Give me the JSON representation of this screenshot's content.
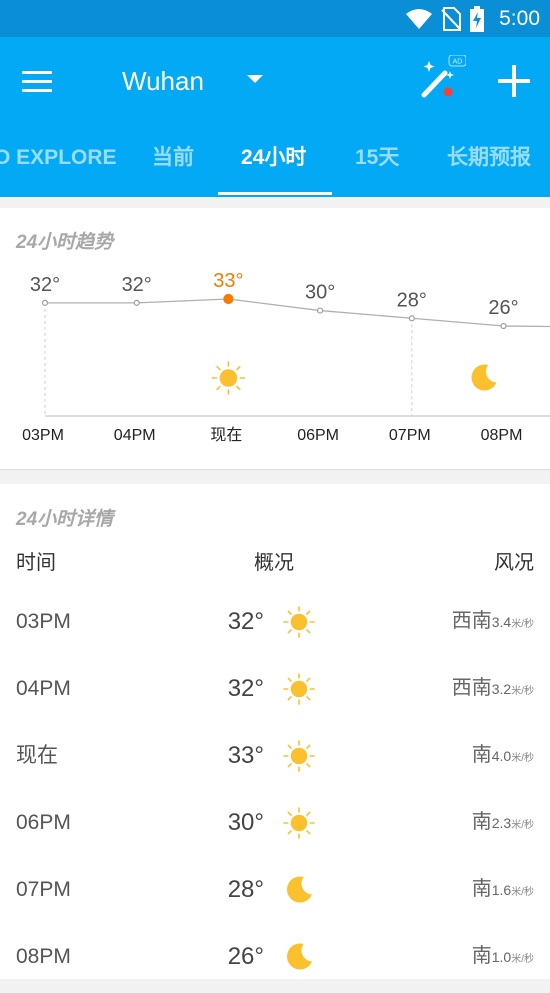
{
  "status_bar": {
    "time": "5:00",
    "icons": [
      "wifi-icon",
      "no-sim-icon",
      "battery-charging-icon"
    ],
    "color": "#0a8fd6"
  },
  "app_bar": {
    "city": "Wuhan",
    "ad_badge": "AD",
    "color": "#03a9f4",
    "tabs": [
      {
        "label": "O EXPLORE",
        "active": false
      },
      {
        "label": "当前",
        "active": false
      },
      {
        "label": "24小时",
        "active": true
      },
      {
        "label": "15天",
        "active": false
      },
      {
        "label": "长期预报",
        "active": false
      }
    ]
  },
  "trend": {
    "title": "24小时趋势",
    "highlight_color": "#f57c00",
    "sun_color": "#fbc02d",
    "hours": [
      {
        "time": "03PM",
        "temp": "32°",
        "current": false
      },
      {
        "time": "04PM",
        "temp": "32°",
        "current": false
      },
      {
        "time": "现在",
        "temp": "33°",
        "current": true
      },
      {
        "time": "06PM",
        "temp": "30°",
        "current": false
      },
      {
        "time": "07PM",
        "temp": "28°",
        "current": false
      },
      {
        "time": "08PM",
        "temp": "26°",
        "current": false
      }
    ],
    "icons": [
      "sun-icon",
      "moon-icon"
    ]
  },
  "detail": {
    "title": "24小时详情",
    "headers": {
      "time": "时间",
      "overview": "概况",
      "wind": "风况"
    },
    "rows": [
      {
        "time": "03PM",
        "temp": "32°",
        "icon": "sun-icon",
        "dir": "西南",
        "speed": "3.4",
        "unit": "米/秒"
      },
      {
        "time": "04PM",
        "temp": "32°",
        "icon": "sun-icon",
        "dir": "西南",
        "speed": "3.2",
        "unit": "米/秒"
      },
      {
        "time": "现在",
        "temp": "33°",
        "icon": "sun-icon",
        "dir": "南",
        "speed": "4.0",
        "unit": "米/秒"
      },
      {
        "time": "06PM",
        "temp": "30°",
        "icon": "sun-icon",
        "dir": "南",
        "speed": "2.3",
        "unit": "米/秒"
      },
      {
        "time": "07PM",
        "temp": "28°",
        "icon": "moon-icon",
        "dir": "南",
        "speed": "1.6",
        "unit": "米/秒"
      },
      {
        "time": "08PM",
        "temp": "26°",
        "icon": "moon-icon",
        "dir": "南",
        "speed": "1.0",
        "unit": "米/秒"
      }
    ]
  }
}
